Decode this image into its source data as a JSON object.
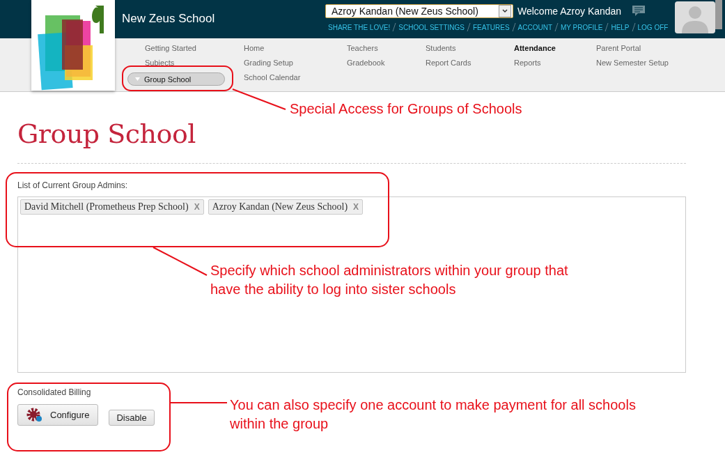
{
  "header": {
    "school_name": "New Zeus School",
    "account_select": {
      "value": "Azroy Kandan (New Zeus School)"
    },
    "welcome": "Welcome Azroy Kandan",
    "links": [
      "SHARE THE LOVE!",
      "SCHOOL SETTINGS",
      "FEATURES",
      "ACCOUNT",
      "MY PROFILE",
      "HELP",
      "LOG OFF"
    ]
  },
  "nav": {
    "columns": [
      [
        {
          "label": "Getting Started",
          "selected": false,
          "kind": "link"
        },
        {
          "label": "Subjects",
          "selected": false,
          "kind": "link"
        },
        {
          "label": "Group School",
          "selected": false,
          "kind": "pill"
        }
      ],
      [
        {
          "label": "Home",
          "selected": false,
          "kind": "link"
        },
        {
          "label": "Grading Setup",
          "selected": false,
          "kind": "link"
        },
        {
          "label": "School Calendar",
          "selected": false,
          "kind": "link"
        }
      ],
      [
        {
          "label": "Teachers",
          "selected": false,
          "kind": "link"
        },
        {
          "label": "Gradebook",
          "selected": false,
          "kind": "link"
        }
      ],
      [
        {
          "label": "Students",
          "selected": false,
          "kind": "link"
        },
        {
          "label": "Report Cards",
          "selected": false,
          "kind": "link"
        }
      ],
      [
        {
          "label": "Attendance",
          "selected": true,
          "kind": "link"
        },
        {
          "label": "Reports",
          "selected": false,
          "kind": "link"
        }
      ],
      [
        {
          "label": "Parent Portal",
          "selected": false,
          "kind": "link"
        },
        {
          "label": "New Semester Setup",
          "selected": false,
          "kind": "link"
        }
      ]
    ]
  },
  "page_title": "Group School",
  "admins": {
    "label": "List of Current Group Admins:",
    "tags": [
      {
        "label": "David Mitchell (Prometheus Prep School)",
        "remove": "X"
      },
      {
        "label": "Azroy Kandan (New Zeus School)",
        "remove": "X"
      }
    ]
  },
  "billing": {
    "label": "Consolidated Billing",
    "buttons": [
      {
        "label": "Configure",
        "kind": "icon"
      },
      {
        "label": "Disable",
        "kind": "plain"
      }
    ]
  },
  "annotations": [
    {
      "text": "Special Access for Groups of Schools"
    },
    {
      "text": "Specify which school administrators within your group that have the ability to log into sister schools"
    },
    {
      "text": "You can also specify one account to make payment for all schools within the group"
    }
  ]
}
